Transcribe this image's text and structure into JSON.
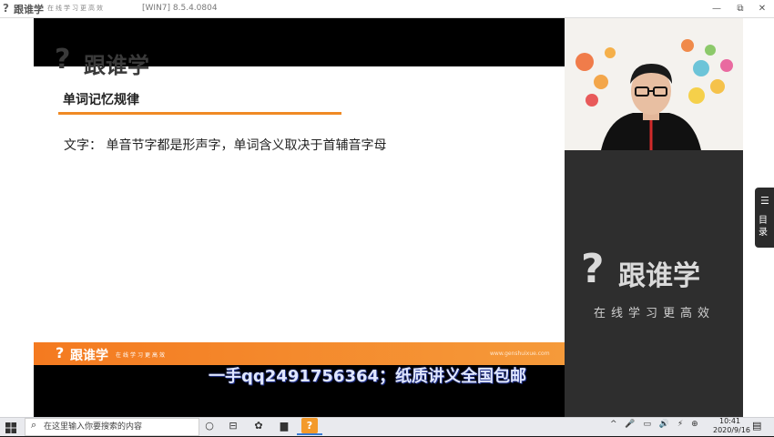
{
  "titlebar": {
    "logo_mark": "?",
    "app_name": "跟谁学",
    "slogan": "在线学习更高效",
    "version": "[WIN7] 8.5.4.0804",
    "minimize": "—",
    "maximize": "⧉",
    "close": "✕"
  },
  "slide": {
    "watermark_q": "?",
    "watermark_text": "跟谁学",
    "title": "单词记忆规律",
    "line_label": "文字：",
    "line_text": "单音节字都是形声字，单词含义取决于首辅音字母",
    "footer_q": "?",
    "footer_name": "跟谁学",
    "footer_slogan": "在线学习更高效",
    "footer_url": "www.genshuixue.com",
    "accent_color": "#f08a24"
  },
  "subtitle": "一手qq2491756364；纸质讲义全国包邮",
  "side_panel": {
    "brand_q": "?",
    "brand_name": "跟谁学",
    "brand_slogan": "在线学习更高效",
    "menu_icon": "☰",
    "menu_label": "目录"
  },
  "taskbar": {
    "search_placeholder": "在这里输入你要搜索的内容",
    "time": "10:41",
    "date": "2020/9/16",
    "tray_icons": "^ 🎤 ▭ 🔊 ⚡ ⊕"
  }
}
